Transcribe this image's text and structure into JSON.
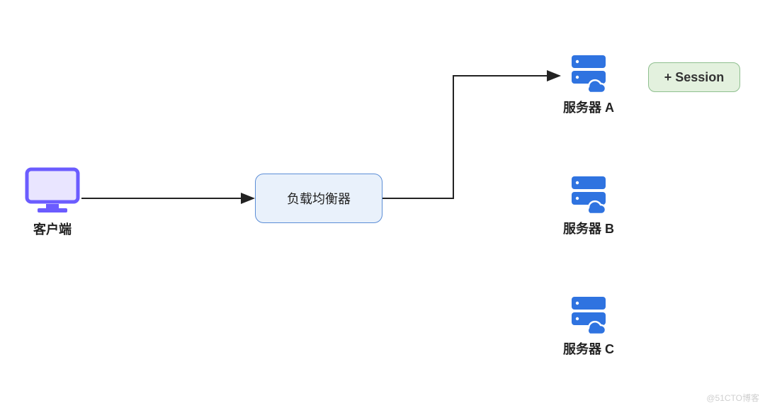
{
  "client": {
    "label": "客户端"
  },
  "load_balancer": {
    "label": "负载均衡器"
  },
  "servers": {
    "a": {
      "label": "服务器 A"
    },
    "b": {
      "label": "服务器 B"
    },
    "c": {
      "label": "服务器 C"
    }
  },
  "session_badge": {
    "label": "+ Session"
  },
  "watermark": "@51CTO博客",
  "colors": {
    "client_icon": "#6b5cff",
    "client_fill": "#e9e5ff",
    "server_icon": "#2f73e0",
    "lb_border": "#5b8dd6",
    "lb_fill": "#e9f1fb",
    "session_border": "#8fbf8f",
    "session_fill": "#e3f1de",
    "arrow": "#222222"
  }
}
